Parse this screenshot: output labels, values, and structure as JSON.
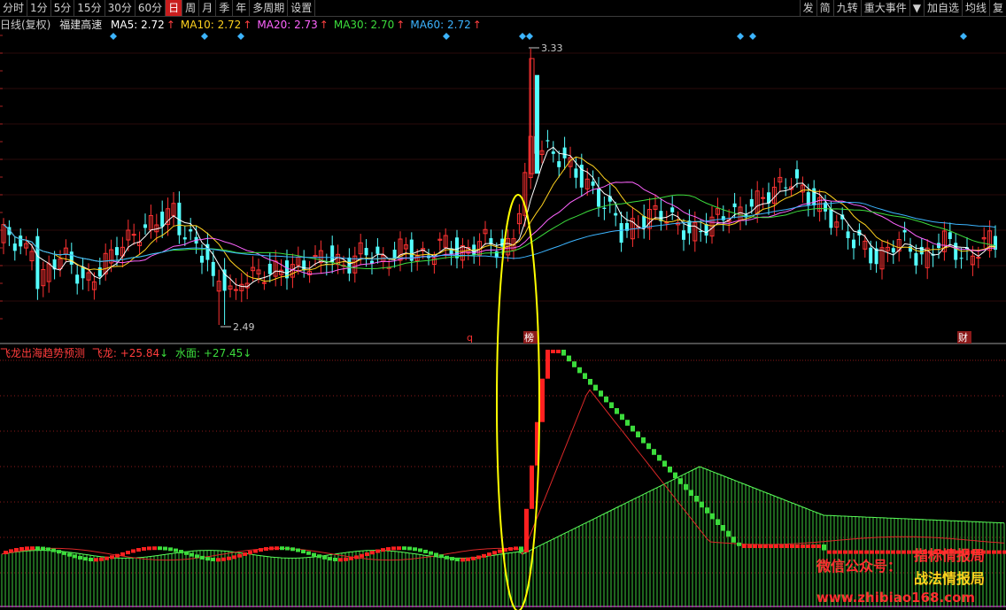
{
  "toolbar": {
    "left": [
      "分时",
      "1分",
      "5分",
      "15分",
      "30分",
      "60分",
      "日",
      "周",
      "月",
      "季",
      "年",
      "多周期",
      "设置"
    ],
    "active_index": 6,
    "right": [
      "发",
      "简",
      "九转",
      "重大事件",
      "▼",
      "加自选",
      "均线",
      "复"
    ]
  },
  "legend": {
    "period": "日线(复权)",
    "stock": "福建高速",
    "ma": [
      {
        "label": "MA5: 2.72",
        "color": "#ffffff"
      },
      {
        "label": "MA10: 2.72",
        "color": "#ffd21e"
      },
      {
        "label": "MA20: 2.73",
        "color": "#ff64ff"
      },
      {
        "label": "MA30: 2.70",
        "color": "#3cdc3c"
      },
      {
        "label": "MA60: 2.72",
        "color": "#3cb4ff"
      }
    ],
    "arrow": "↑"
  },
  "indicator": {
    "name": "飞龙出海趋势预测",
    "line1_label": "飞龙: +25.84",
    "line1_arrow": "↓",
    "line2_label": "水面: +27.45",
    "line2_arrow": "↓",
    "name_color": "#ff3c3c",
    "line2_color": "#3cdc3c"
  },
  "annotations": {
    "high_label": "3.33",
    "low_label": "2.49",
    "marker_q": "q",
    "marker_bang": "榜",
    "marker_cai": "财"
  },
  "watermark": {
    "line1": "指标情报局",
    "line2": "微信公众号：",
    "line3": "战法情报局",
    "line4": "www.zhibiao168.com"
  },
  "colors": {
    "up": "#ff3232",
    "down": "#54ffff",
    "grid": "#8b1a1a",
    "highlight_ellipse": "#ffff00",
    "water_bar": "#3cc83c"
  },
  "chart_data": {
    "type": "candlestick",
    "price_range": [
      2.49,
      3.33
    ],
    "high": 3.33,
    "low": 2.49,
    "ma_latest": {
      "MA5": 2.72,
      "MA10": 2.72,
      "MA20": 2.73,
      "MA30": 2.7,
      "MA60": 2.72
    },
    "indicator_latest": {
      "飞龙": 25.84,
      "水面": 27.45
    }
  }
}
